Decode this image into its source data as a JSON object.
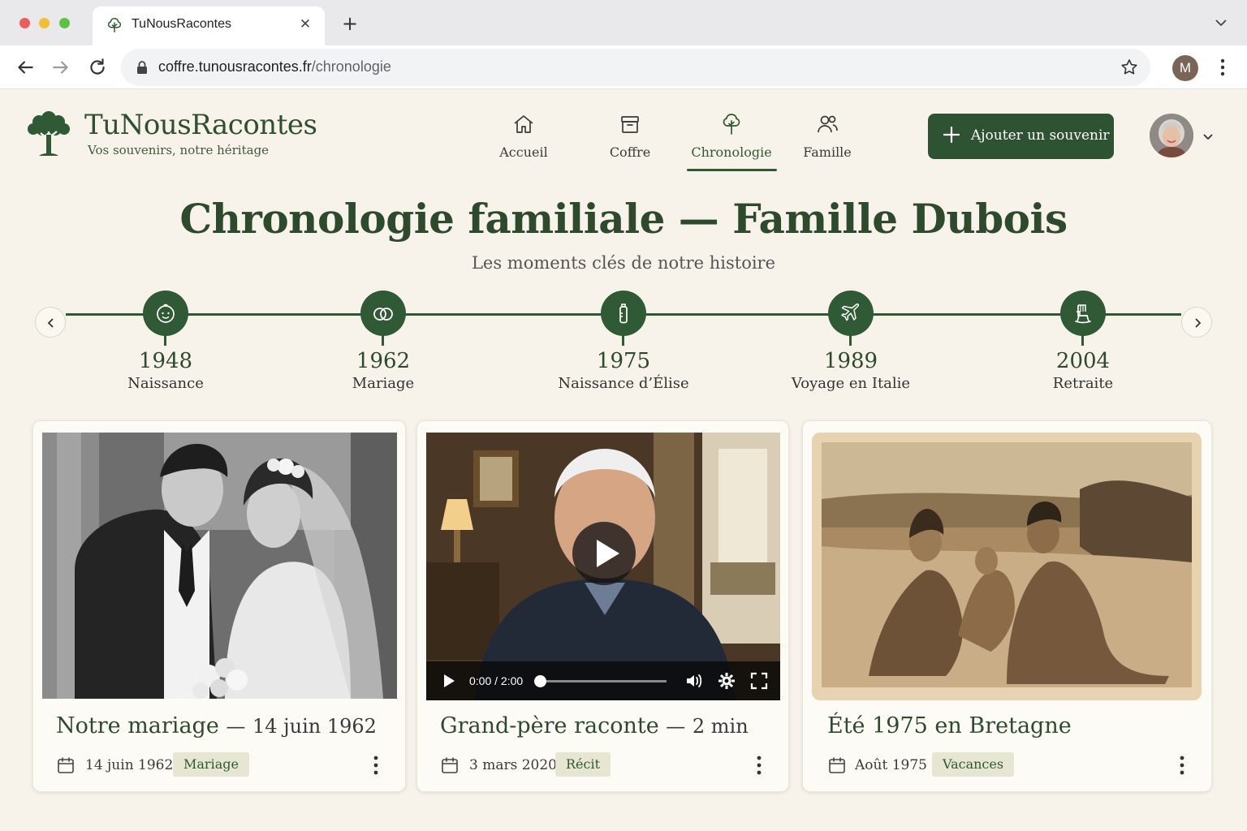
{
  "browser": {
    "tab_title": "TuNousRacontes",
    "url_host": "coffre.tunousracontes.fr",
    "url_path": "/chronologie",
    "profile_initial": "M"
  },
  "app": {
    "brand": "TuNousRacontes",
    "tagline": "Vos souvenirs, notre héritage",
    "nav": [
      {
        "label": "Accueil",
        "icon": "home-icon"
      },
      {
        "label": "Coffre",
        "icon": "archive-box-icon"
      },
      {
        "label": "Chronologie",
        "icon": "tree-icon",
        "active": true
      },
      {
        "label": "Famille",
        "icon": "people-icon"
      }
    ],
    "add_button": "Ajouter un souvenir",
    "accent_color": "#2d5333"
  },
  "page": {
    "title": "Chronologie familiale — Famille Dubois",
    "subtitle": "Les moments clés de notre histoire"
  },
  "timeline": [
    {
      "year": "1948",
      "label": "Naissance",
      "icon": "baby-icon"
    },
    {
      "year": "1962",
      "label": "Mariage",
      "icon": "rings-icon"
    },
    {
      "year": "1975",
      "label": "Naissance d’Élise",
      "icon": "baby-bottle-icon"
    },
    {
      "year": "1989",
      "label": "Voyage en Italie",
      "icon": "airplane-icon"
    },
    {
      "year": "2004",
      "label": "Retraite",
      "icon": "rocking-chair-icon"
    }
  ],
  "cards": [
    {
      "title": "Notre mariage",
      "title_suffix": "14 juin 1962",
      "date": "14 juin 1962",
      "tag": "Mariage",
      "media": "photo"
    },
    {
      "title": "Grand-père raconte",
      "title_suffix": "2 min",
      "date": "3 mars 2020",
      "tag": "Récit",
      "media": "video",
      "video_time": "0:00 / 2:00",
      "video_progress": 0
    },
    {
      "title": "Été 1975 en Bretagne",
      "title_suffix": "",
      "date": "Août 1975",
      "tag": "Vacances",
      "media": "photo"
    }
  ],
  "separator": "—"
}
